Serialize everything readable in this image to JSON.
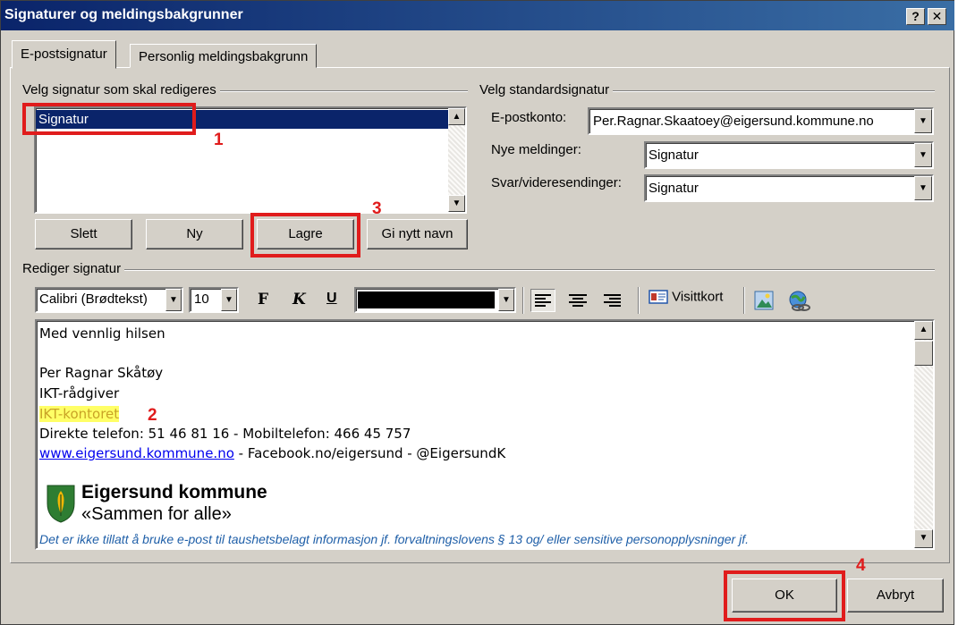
{
  "window": {
    "title": "Signaturer og meldingsbakgrunner",
    "help_label": "?",
    "close_label": "✕"
  },
  "tabs": [
    {
      "label": "E-postsignatur",
      "active": true
    },
    {
      "label": "Personlig meldingsbakgrunn",
      "active": false
    }
  ],
  "select_group": {
    "title": "Velg signatur som skal redigeres",
    "items": [
      "Signatur"
    ],
    "buttons": {
      "delete": "Slett",
      "new": "Ny",
      "save": "Lagre",
      "rename": "Gi nytt navn"
    }
  },
  "default_group": {
    "title": "Velg standardsignatur",
    "account_label": "E-postkonto:",
    "account_value": "Per.Ragnar.Skaatoey@eigersund.kommune.no",
    "new_label": "Nye meldinger:",
    "new_value": "Signatur",
    "reply_label": "Svar/videresendinger:",
    "reply_value": "Signatur"
  },
  "editor": {
    "title": "Rediger signatur",
    "toolbar": {
      "font": "Calibri (Brødtekst)",
      "size": "10",
      "bold": "F",
      "italic": "K",
      "underline": "U",
      "color": "#000000",
      "business_card": "Visittkort"
    },
    "lines": {
      "greeting": "Med vennlig hilsen",
      "name": "Per Ragnar Skåtøy",
      "role": "IKT-rådgiver",
      "dept": "IKT-kontoret",
      "phone": "Direkte telefon: 51 46 81 16 - Mobiltelefon: 466 45 757",
      "link": "www.eigersund.kommune.no",
      "social": " - Facebook.no/eigersund - @EigersundK",
      "logo_name": "Eigersund kommune",
      "logo_slogan": "«Sammen for alle»",
      "disclaimer": "Det er ikke tillatt å bruke e-post til taushetsbelagt informasjon jf. forvaltningslovens § 13 og/ eller sensitive personopplysninger jf."
    }
  },
  "footer": {
    "ok": "OK",
    "cancel": "Avbryt"
  },
  "annotations": {
    "n1": "1",
    "n2": "2",
    "n3": "3",
    "n4": "4"
  },
  "colors": {
    "title_bar": "#0a246a",
    "annotation_red": "#e01c1c",
    "highlight": "#ffff66",
    "link": "#0000ee",
    "disclaimer": "#1f5fa8"
  }
}
